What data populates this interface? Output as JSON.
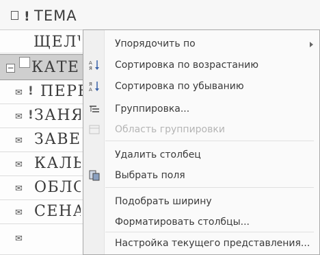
{
  "list": {
    "header_title": "ТЕМА",
    "header_flag": "!",
    "rows": [
      {
        "text": "ЩЕЛЧО"
      },
      {
        "text": "КАТЕГ"
      },
      {
        "text": "ПЕРЕ"
      },
      {
        "text": "ЗАНЯТ"
      },
      {
        "text": "ЗАВЕР"
      },
      {
        "text": "КАЛЫГ"
      },
      {
        "text": "ОБЛОЖ"
      },
      {
        "text": "СЕНАТ"
      }
    ],
    "flag": "!",
    "expand": "−"
  },
  "menu": {
    "items": [
      {
        "label": "Упорядочить по",
        "has_submenu": true,
        "icon": "none"
      },
      {
        "label": "Сортировка по возрастанию",
        "icon": "sort-ascending-icon"
      },
      {
        "label": "Сортировка по убыванию",
        "icon": "sort-descending-icon"
      },
      {
        "label": "Группировка...",
        "icon": "group-by-icon"
      },
      {
        "label": "Область группировки",
        "icon": "group-area-icon",
        "disabled": true
      },
      {
        "label": "Удалить столбец",
        "icon": "none"
      },
      {
        "label": "Выбрать поля",
        "icon": "field-chooser-icon"
      },
      {
        "label": "Подобрать ширину",
        "icon": "none"
      },
      {
        "label": "Форматировать столбцы...",
        "icon": "none"
      },
      {
        "label": "Настройка текущего представления...",
        "icon": "none"
      }
    ]
  }
}
